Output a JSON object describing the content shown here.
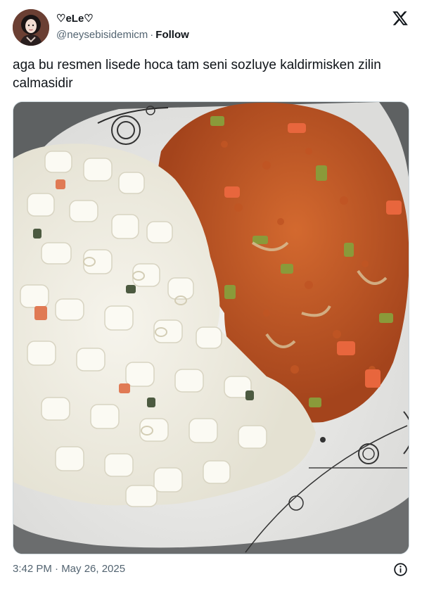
{
  "author": {
    "display_name": "♡eLe♡",
    "handle": "@neysebisidemicm",
    "separator": "·",
    "follow_label": "Follow"
  },
  "tweet": {
    "text": "aga bu resmen lisede hoca tam seni sozluye kaldirmisken zilin calmasidir"
  },
  "footer": {
    "timestamp": "3:42 PM · May 26, 2025"
  },
  "icons": {
    "brand": "x-logo-icon",
    "info": "info-icon"
  },
  "colors": {
    "text_primary": "#0f1419",
    "text_secondary": "#536471",
    "border": "#cfd9de"
  }
}
